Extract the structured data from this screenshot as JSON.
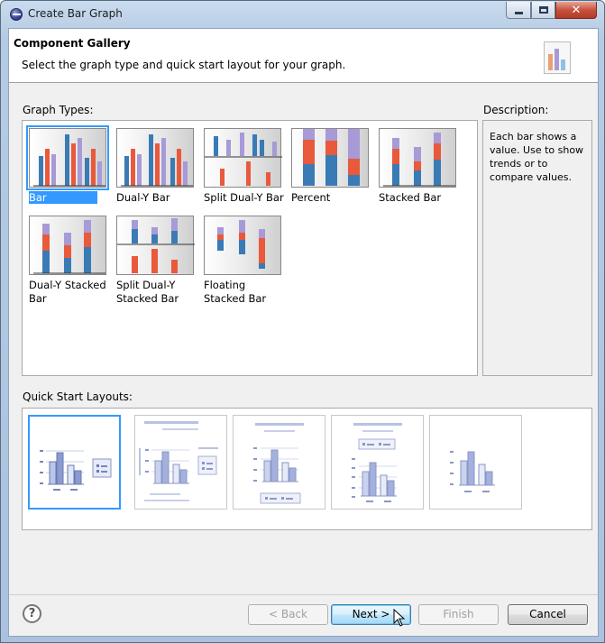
{
  "window": {
    "title": "Create Bar Graph"
  },
  "banner": {
    "title": "Component Gallery",
    "description": "Select the graph type and quick start layout for your graph."
  },
  "graph_types": {
    "label": "Graph Types:",
    "selected": "Bar",
    "items": [
      {
        "label": "Bar",
        "icon": "bar-chart-icon"
      },
      {
        "label": "Dual-Y Bar",
        "icon": "dual-y-bar-chart-icon"
      },
      {
        "label": "Split Dual-Y Bar",
        "icon": "split-dual-y-bar-chart-icon"
      },
      {
        "label": "Percent",
        "icon": "percent-bar-chart-icon"
      },
      {
        "label": "Stacked Bar",
        "icon": "stacked-bar-chart-icon"
      },
      {
        "label": "Dual-Y Stacked Bar",
        "icon": "dual-y-stacked-bar-chart-icon"
      },
      {
        "label": "Split Dual-Y Stacked Bar",
        "icon": "split-dual-y-stacked-bar-chart-icon"
      },
      {
        "label": "Floating Stacked Bar",
        "icon": "floating-stacked-bar-chart-icon"
      }
    ]
  },
  "description": {
    "label": "Description:",
    "text": "Each bar shows a value. Use to show trends or to compare values."
  },
  "quick_start": {
    "label": "Quick Start Layouts:",
    "selected_index": 0,
    "layouts": [
      "layout-legend-right",
      "layout-title-legend-right",
      "layout-title-legend-bottom",
      "layout-title-legend-top",
      "layout-chart-only"
    ]
  },
  "buttons": {
    "help": "?",
    "back": "< Back",
    "next": "Next >",
    "finish": "Finish",
    "cancel": "Cancel"
  },
  "colors": {
    "selection": "#3399ff",
    "bar_blue": "#3a7bb5",
    "bar_red": "#e9593c",
    "bar_purple": "#a89ad6"
  }
}
